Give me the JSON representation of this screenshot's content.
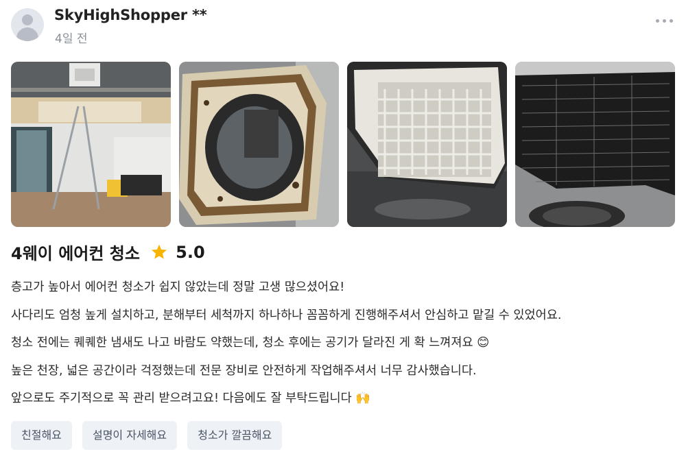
{
  "review": {
    "username": "SkyHighShopper **",
    "time_ago": "4일 전",
    "title": "4웨이 에어컨 청소",
    "rating": "5.0",
    "lines": [
      "층고가 높아서 에어컨 청소가 쉽지 않았는데 정말 고생 많으셨어요!",
      "사다리도 엄청 높게 설치하고, 분해부터 세척까지 하나하나 꼼꼼하게 진행해주셔서 안심하고 맡길 수 있었어요.",
      "청소 전에는 퀘퀘한 냄새도 나고 바람도 약했는데, 청소 후에는 공기가 달라진 게 확 느껴져요 😊",
      "높은 천장, 넓은 공간이라 걱정했는데 전문 장비로 안전하게 작업해주셔서 너무 감사했습니다.",
      "앞으로도 주기적으로 꼭 관리 받으려고요! 다음에도 잘 부탁드립니다 🙌"
    ],
    "tags": [
      "친절해요",
      "설명이 자세해요",
      "청소가 깔끔해요"
    ]
  },
  "icons": {
    "avatar": "default-user-avatar",
    "more": "more-horizontal-icon",
    "star": "star-icon"
  },
  "colors": {
    "star": "#f7b500",
    "tag_bg": "#eef1f6",
    "tag_text": "#4b5464",
    "muted_text": "#8a8f98"
  }
}
